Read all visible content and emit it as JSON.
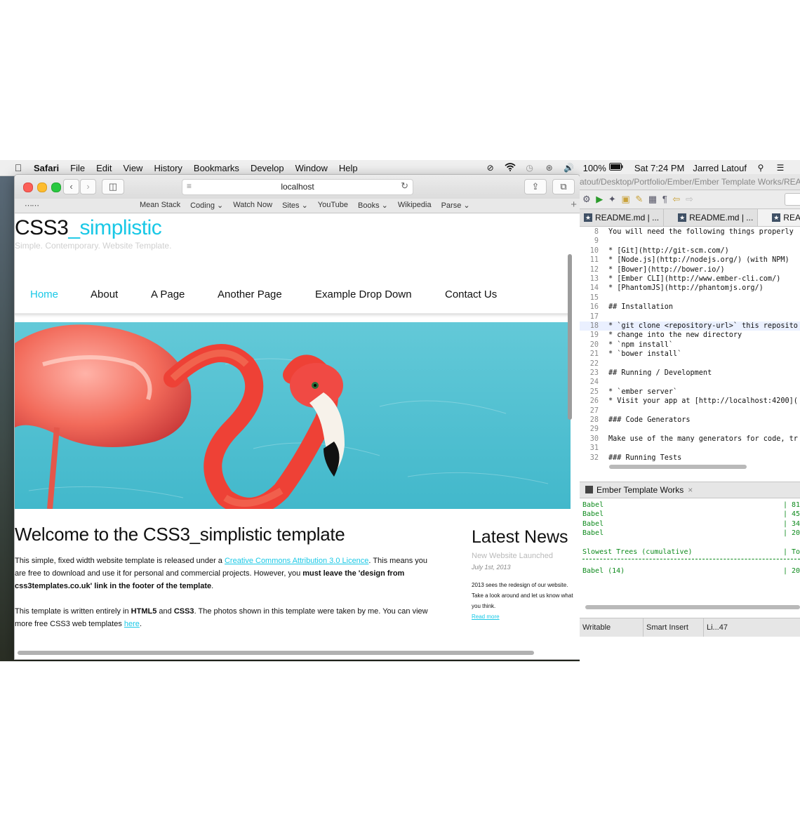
{
  "menubar": {
    "app": "Safari",
    "items": [
      "File",
      "Edit",
      "View",
      "History",
      "Bookmarks",
      "Develop",
      "Window",
      "Help"
    ],
    "battery": "100%",
    "datetime": "Sat 7:24 PM",
    "user": "Jarred Latouf"
  },
  "browser": {
    "url": "localhost",
    "favorites": [
      "Mean Stack",
      "Coding ⌄",
      "Watch Now",
      "Sites ⌄",
      "YouTube",
      "Books ⌄",
      "Wikipedia",
      "Parse ⌄"
    ]
  },
  "site": {
    "logo_main": "CSS3",
    "logo_accent": "_simplistic",
    "slogan": "Simple. Contemporary. Website Template.",
    "nav": [
      "Home",
      "About",
      "A Page",
      "Another Page",
      "Example Drop Down",
      "Contact Us"
    ],
    "heading": "Welcome to the CSS3_simplistic template",
    "para1_a": "This simple, fixed width website template is released under a ",
    "para1_link": "Creative Commons Attribution 3.0 Licence",
    "para1_b": ". This means you are free to download and use it for personal and commercial projects. However, you ",
    "para1_bold": "must leave the 'design from css3templates.co.uk' link in the footer of the template",
    "para1_c": ".",
    "para2_a": "This template is written entirely in ",
    "para2_html5": "HTML5",
    "para2_and": " and ",
    "para2_css3": "CSS3",
    "para2_b": ". The photos shown in this template were taken by me. You can view more free CSS3 web templates ",
    "para2_link": "here",
    "para2_c": ".",
    "sidebar": {
      "title": "Latest News",
      "subtitle": "New Website Launched",
      "date": "July 1st, 2013",
      "text": "2013 sees the redesign of our website. Take a look around and let us know what you think.",
      "read_more": "Read more"
    }
  },
  "editor": {
    "path": "atouf/Desktop/Portfolio/Ember/Ember Template Works/README.md",
    "tabs": [
      "README.md | ...",
      "README.md | ...",
      "README.md"
    ],
    "lines": [
      {
        "n": "8",
        "t": "You will need the following things properly"
      },
      {
        "n": "9",
        "t": ""
      },
      {
        "n": "10",
        "t": "* [Git](http://git-scm.com/)"
      },
      {
        "n": "11",
        "t": "* [Node.js](http://nodejs.org/) (with NPM)"
      },
      {
        "n": "12",
        "t": "* [Bower](http://bower.io/)"
      },
      {
        "n": "13",
        "t": "* [Ember CLI](http://www.ember-cli.com/)"
      },
      {
        "n": "14",
        "t": "* [PhantomJS](http://phantomjs.org/)"
      },
      {
        "n": "15",
        "t": ""
      },
      {
        "n": "16",
        "t": "## Installation"
      },
      {
        "n": "17",
        "t": ""
      },
      {
        "n": "18",
        "t": "* `git clone <repository-url>` this reposito"
      },
      {
        "n": "19",
        "t": "* change into the new directory"
      },
      {
        "n": "20",
        "t": "* `npm install`"
      },
      {
        "n": "21",
        "t": "* `bower install`"
      },
      {
        "n": "22",
        "t": ""
      },
      {
        "n": "23",
        "t": "## Running / Development"
      },
      {
        "n": "24",
        "t": ""
      },
      {
        "n": "25",
        "t": "* `ember server`"
      },
      {
        "n": "26",
        "t": "* Visit your app at [http://localhost:4200]("
      },
      {
        "n": "27",
        "t": ""
      },
      {
        "n": "28",
        "t": "### Code Generators"
      },
      {
        "n": "29",
        "t": ""
      },
      {
        "n": "30",
        "t": "Make use of the many generators for code, tr"
      },
      {
        "n": "31",
        "t": ""
      },
      {
        "n": "32",
        "t": "### Running Tests"
      }
    ],
    "console_title": "Ember Template Works",
    "console_rows": [
      {
        "l": "Babel",
        "r": "| 81"
      },
      {
        "l": "Babel",
        "r": "| 45"
      },
      {
        "l": "Babel",
        "r": "| 34"
      },
      {
        "l": "Babel",
        "r": "| 20"
      },
      {
        "l": "",
        "r": ""
      },
      {
        "l": "Slowest Trees (cumulative)",
        "r": "| To"
      },
      {
        "l": "",
        "r": ""
      },
      {
        "l": "Babel (14)",
        "r": "| 20"
      }
    ],
    "status": [
      "Writable",
      "Smart Insert",
      "Li...47"
    ]
  }
}
